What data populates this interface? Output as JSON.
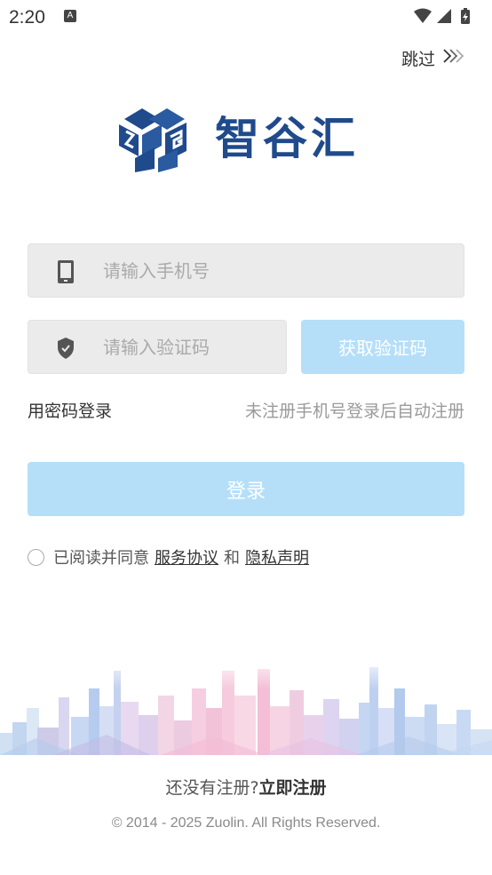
{
  "status_bar": {
    "time": "2:20",
    "notification_icon": "A"
  },
  "header": {
    "skip_label": "跳过"
  },
  "brand": {
    "name": "智谷汇",
    "color": "#1f4a8c"
  },
  "login_form": {
    "phone_placeholder": "请输入手机号",
    "code_placeholder": "请输入验证码",
    "get_code_label": "获取验证码",
    "password_login_label": "用密码登录",
    "auto_register_hint": "未注册手机号登录后自动注册",
    "login_button_label": "登录",
    "button_color": "#b5dff8"
  },
  "agreement": {
    "prefix": "已阅读并同意",
    "service_link": "服务协议",
    "joiner": "和",
    "privacy_link": "隐私声明"
  },
  "footer": {
    "no_account_text": "还没有注册?",
    "register_link": "立即注册",
    "copyright": "© 2014 - 2025 Zuolin. All Rights Reserved."
  }
}
